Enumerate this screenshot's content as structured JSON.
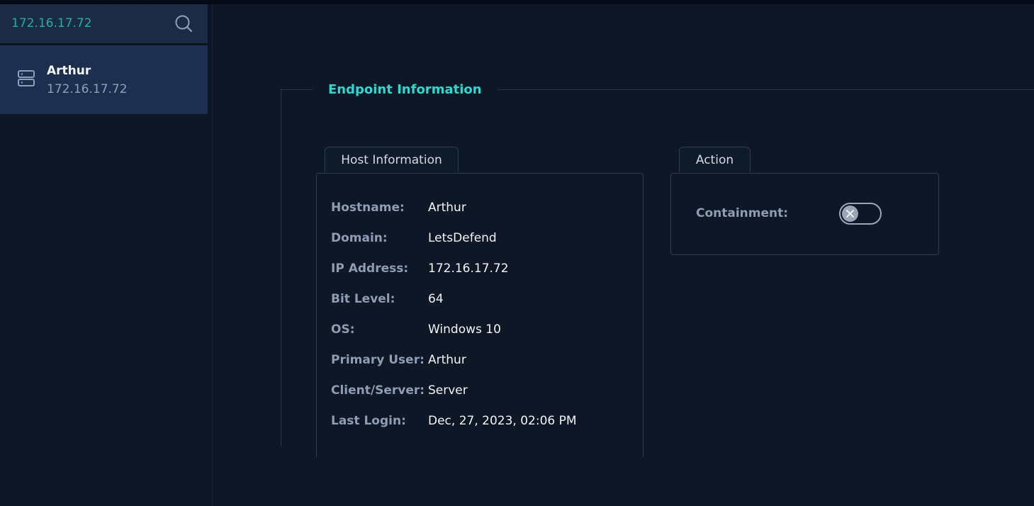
{
  "search": {
    "value": "172.16.17.72"
  },
  "host_list": [
    {
      "name": "Arthur",
      "ip": "172.16.17.72"
    }
  ],
  "endpoint": {
    "title": "Endpoint Information",
    "host_tab": "Host Information",
    "action_tab": "Action",
    "fields": [
      {
        "label": "Hostname:",
        "value": "Arthur"
      },
      {
        "label": "Domain:",
        "value": "LetsDefend"
      },
      {
        "label": "IP Address:",
        "value": "172.16.17.72"
      },
      {
        "label": "Bit Level:",
        "value": "64"
      },
      {
        "label": "OS:",
        "value": "Windows 10"
      },
      {
        "label": "Primary User:",
        "value": "Arthur"
      },
      {
        "label": "Client/Server:",
        "value": "Server"
      },
      {
        "label": "Last Login:",
        "value": "Dec, 27, 2023, 02:06 PM"
      }
    ],
    "containment_label": "Containment:",
    "containment_enabled": false
  },
  "icons": {
    "search": "search-icon",
    "server": "server-icon",
    "toggle_off": "close-icon"
  },
  "colors": {
    "background": "#0e1726",
    "accent": "#2ad9d1",
    "search_text": "#1bb3a0",
    "selected_item": "#1d2f4e"
  }
}
